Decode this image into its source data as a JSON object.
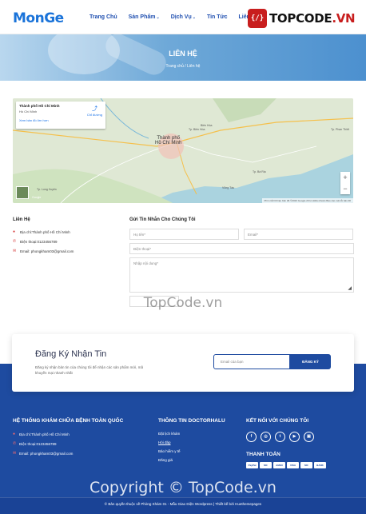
{
  "header": {
    "logo_prefix": "Mon",
    "logo_suffix": "Ge",
    "nav": [
      {
        "label": "Trang Chủ",
        "caret": ""
      },
      {
        "label": "Sản Phẩm",
        "caret": "⌄"
      },
      {
        "label": "Dịch Vụ",
        "caret": "⌄"
      },
      {
        "label": "Tin Tức",
        "caret": ""
      },
      {
        "label": "Liên Hệ",
        "caret": ""
      }
    ],
    "badge_logo": {
      "badge": "{/}",
      "text": "TOPCODE",
      "suffix": ".VN"
    }
  },
  "banner": {
    "title": "LIÊN HỆ",
    "breadcrumb": "Trang chủ  /  Liên hệ"
  },
  "map": {
    "card_title": "Thành phố Hồ Chí Minh",
    "card_subtitle": "Hồ Chí Minh",
    "card_link": "Xem bản đồ lớn hơn",
    "directions": "Chỉ đường",
    "city_label": "Thành phố\nHồ Chí Minh",
    "places": [
      "Biên Hòa",
      "Tp. Biên Hòa",
      "Tp. Phan Thiết",
      "Tp. Long Xuyên",
      "Vũng Tàu",
      "Tp. Bà Rịa",
      "Google"
    ],
    "zoom_in": "+",
    "zoom_out": "−",
    "footer": "Phím tắt   Dữ liệu bản đồ ©2023 Google   20 km   Điều khoản   Báo cáo một lỗi bản đồ"
  },
  "contact": {
    "title": "Liên Hệ",
    "address": "Địa chỉ:Thành phố Hồ Chí Minh",
    "phone": "Điện thoại:0123456789",
    "email": "Email: phongkham03@gmail.com",
    "form_title": "Gửi Tin Nhắn Cho Chúng Tôi",
    "name_placeholder": "Họ tên*",
    "email_placeholder": "Email*",
    "phone_placeholder": "Điện thoại*",
    "content_placeholder": "Nhập nội dung*",
    "send_label": ""
  },
  "watermarks": {
    "middle": "TopCode.vn",
    "bottom": "Copyright © TopCode.vn"
  },
  "newsletter": {
    "title": "Đăng Ký Nhận Tin",
    "desc": "Đăng ký nhận bản tin của chúng tôi để nhận các sản phẩm mới, mã khuyến mại nhanh nhất",
    "input_placeholder": "Email của bạn",
    "button": "ĐĂNG KÝ"
  },
  "footer": {
    "col1": {
      "title": "HỆ THỐNG KHÁM CHỮA BỆNH TOÀN QUỐC",
      "address": "Địa chỉ:Thành phố Hồ Chí Minh",
      "phone": "Điện thoại:0123456789",
      "email": "Email: phongkham03@gmail.com"
    },
    "col2": {
      "title": "THÔNG TIN DOCTORHALU",
      "links": [
        "Đặt lịch khám",
        "Hỏi đáp",
        "Bảo hiểm y tế",
        "Đăng giá"
      ]
    },
    "col3": {
      "title": "KẾT NỐI VỚI CHÚNG TÔI",
      "socials": [
        "f",
        "◎",
        "t",
        "▶",
        "▣"
      ],
      "pay_title": "THANH TOÁN",
      "pays": [
        "PayPal",
        "MC",
        "AMEX",
        "VISA",
        "MC",
        "BANK"
      ]
    },
    "copyright": "© Bản quyền thuộc về Phòng Khám 01 - Mẫu Giao Diện Wordpress  |  Thiết kế bởi Huethemepages"
  },
  "colors": {
    "brand_blue": "#1e4ba0",
    "nav_blue": "#1f4fb0",
    "accent_red": "#d63a3a"
  }
}
